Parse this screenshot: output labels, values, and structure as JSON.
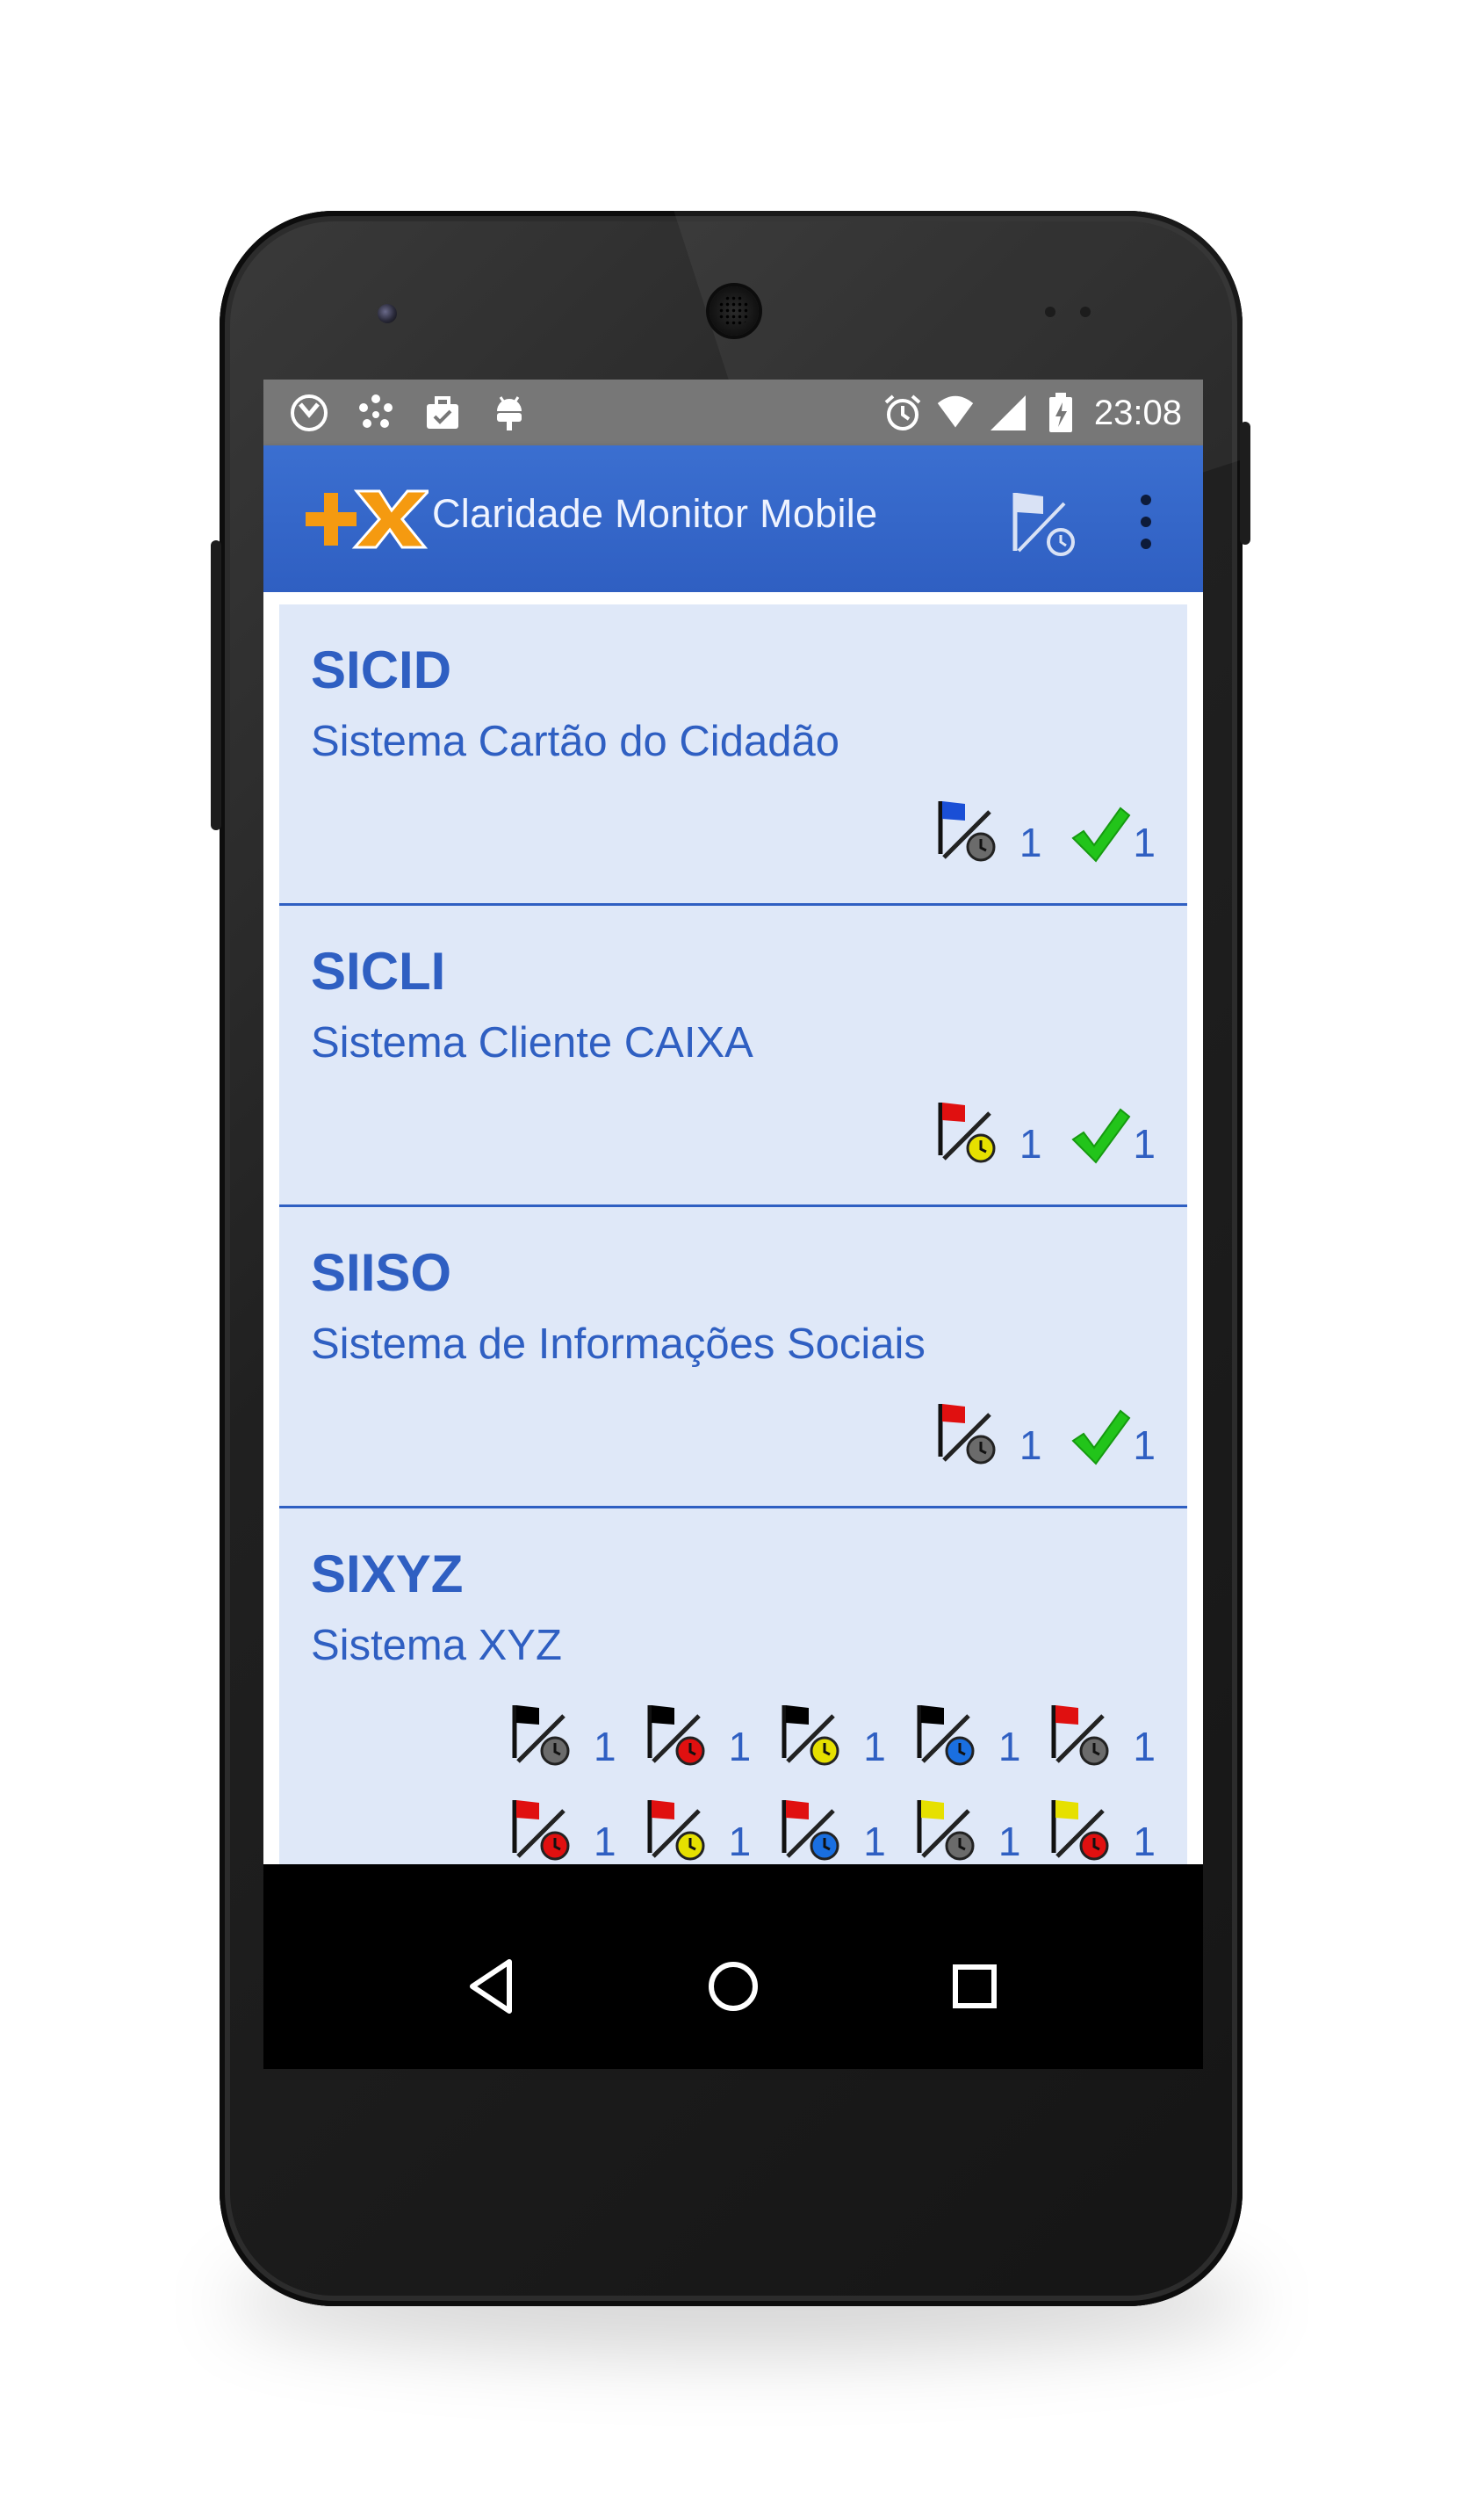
{
  "status_bar": {
    "time": "23:08",
    "left_icons": [
      "clock-badge-icon",
      "dots-cluster-icon",
      "briefcase-icon",
      "android-debug-icon"
    ],
    "right_icons": [
      "alarm-icon",
      "wifi-icon",
      "signal-icon",
      "battery-charging-icon"
    ]
  },
  "app_bar": {
    "title": "Claridade Monitor Mobile",
    "actions": [
      "flag-clock-action",
      "overflow-menu"
    ]
  },
  "colors": {
    "accent": "#2f5fc2",
    "card_bg": "#dfe8f8",
    "check": "#22c41a",
    "flag_blue": "#1a4fd6",
    "flag_red": "#e01010",
    "flag_black": "#000000",
    "flag_yellow": "#e6e000"
  },
  "systems": [
    {
      "code": "SICID",
      "name": "Sistema Cartão do Cidadão",
      "statuses": [
        {
          "type": "flag",
          "flag": "blue",
          "clock": "gray",
          "count": "1"
        },
        {
          "type": "check",
          "count": "1"
        }
      ]
    },
    {
      "code": "SICLI",
      "name": "Sistema Cliente CAIXA",
      "statuses": [
        {
          "type": "flag",
          "flag": "red",
          "clock": "yellow",
          "count": "1"
        },
        {
          "type": "check",
          "count": "1"
        }
      ]
    },
    {
      "code": "SIISO",
      "name": "Sistema de Informações Sociais",
      "statuses": [
        {
          "type": "flag",
          "flag": "red",
          "clock": "gray",
          "count": "1"
        },
        {
          "type": "check",
          "count": "1"
        }
      ]
    },
    {
      "code": "SIXYZ",
      "name": "Sistema XYZ",
      "statuses": [
        {
          "type": "flag",
          "flag": "black",
          "clock": "gray",
          "count": "1"
        },
        {
          "type": "flag",
          "flag": "black",
          "clock": "red",
          "count": "1"
        },
        {
          "type": "flag",
          "flag": "black",
          "clock": "yellow",
          "count": "1"
        },
        {
          "type": "flag",
          "flag": "black",
          "clock": "blue",
          "count": "1"
        },
        {
          "type": "flag",
          "flag": "red",
          "clock": "gray",
          "count": "1"
        },
        {
          "type": "flag",
          "flag": "red",
          "clock": "red",
          "count": "1"
        },
        {
          "type": "flag",
          "flag": "red",
          "clock": "yellow",
          "count": "1"
        },
        {
          "type": "flag",
          "flag": "red",
          "clock": "blue",
          "count": "1"
        },
        {
          "type": "flag",
          "flag": "yellow",
          "clock": "gray",
          "count": "1"
        },
        {
          "type": "flag",
          "flag": "yellow",
          "clock": "red",
          "count": "1"
        }
      ]
    }
  ],
  "nav_bar": [
    "back-icon",
    "home-icon",
    "recents-icon"
  ]
}
